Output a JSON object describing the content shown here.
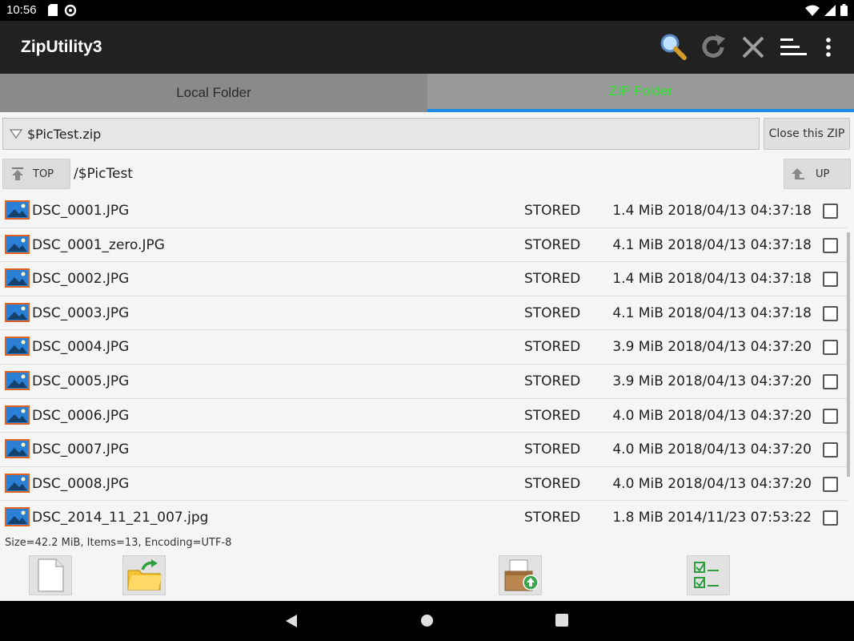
{
  "status_bar": {
    "time": "10:56"
  },
  "app_bar": {
    "title": "ZipUtility3",
    "actions": [
      "search-icon",
      "refresh-icon",
      "close-icon",
      "sort-icon",
      "more-options-icon"
    ]
  },
  "tabs": [
    {
      "label": "Local Folder",
      "selected": false
    },
    {
      "label": "ZIP Folder",
      "selected": true
    }
  ],
  "zip_selector": {
    "value": "$PicTest.zip",
    "close_label": "Close this ZIP"
  },
  "nav": {
    "top_label": "TOP",
    "path": "/$PicTest",
    "up_label": "UP"
  },
  "files": [
    {
      "name": "DSC_0001.JPG",
      "method": "STORED",
      "info": "1.4 MiB 2018/04/13 04:37:18"
    },
    {
      "name": "DSC_0001_zero.JPG",
      "method": "STORED",
      "info": "4.1 MiB 2018/04/13 04:37:18"
    },
    {
      "name": "DSC_0002.JPG",
      "method": "STORED",
      "info": "1.4 MiB 2018/04/13 04:37:18"
    },
    {
      "name": "DSC_0003.JPG",
      "method": "STORED",
      "info": "4.1 MiB 2018/04/13 04:37:18"
    },
    {
      "name": "DSC_0004.JPG",
      "method": "STORED",
      "info": "3.9 MiB 2018/04/13 04:37:20"
    },
    {
      "name": "DSC_0005.JPG",
      "method": "STORED",
      "info": "3.9 MiB 2018/04/13 04:37:20"
    },
    {
      "name": "DSC_0006.JPG",
      "method": "STORED",
      "info": "4.0 MiB 2018/04/13 04:37:20"
    },
    {
      "name": "DSC_0007.JPG",
      "method": "STORED",
      "info": "4.0 MiB 2018/04/13 04:37:20"
    },
    {
      "name": "DSC_0008.JPG",
      "method": "STORED",
      "info": "4.0 MiB 2018/04/13 04:37:20"
    },
    {
      "name": "DSC_2014_11_21_007.jpg",
      "method": "STORED",
      "info": "1.8 MiB 2014/11/23 07:53:22"
    }
  ],
  "summary": "Size=42.2 MiB, Items=13, Encoding=UTF-8",
  "colors": {
    "tab_selected_text": "#2ee02e",
    "tab_indicator": "#1e88e5",
    "app_bar": "#212121"
  }
}
